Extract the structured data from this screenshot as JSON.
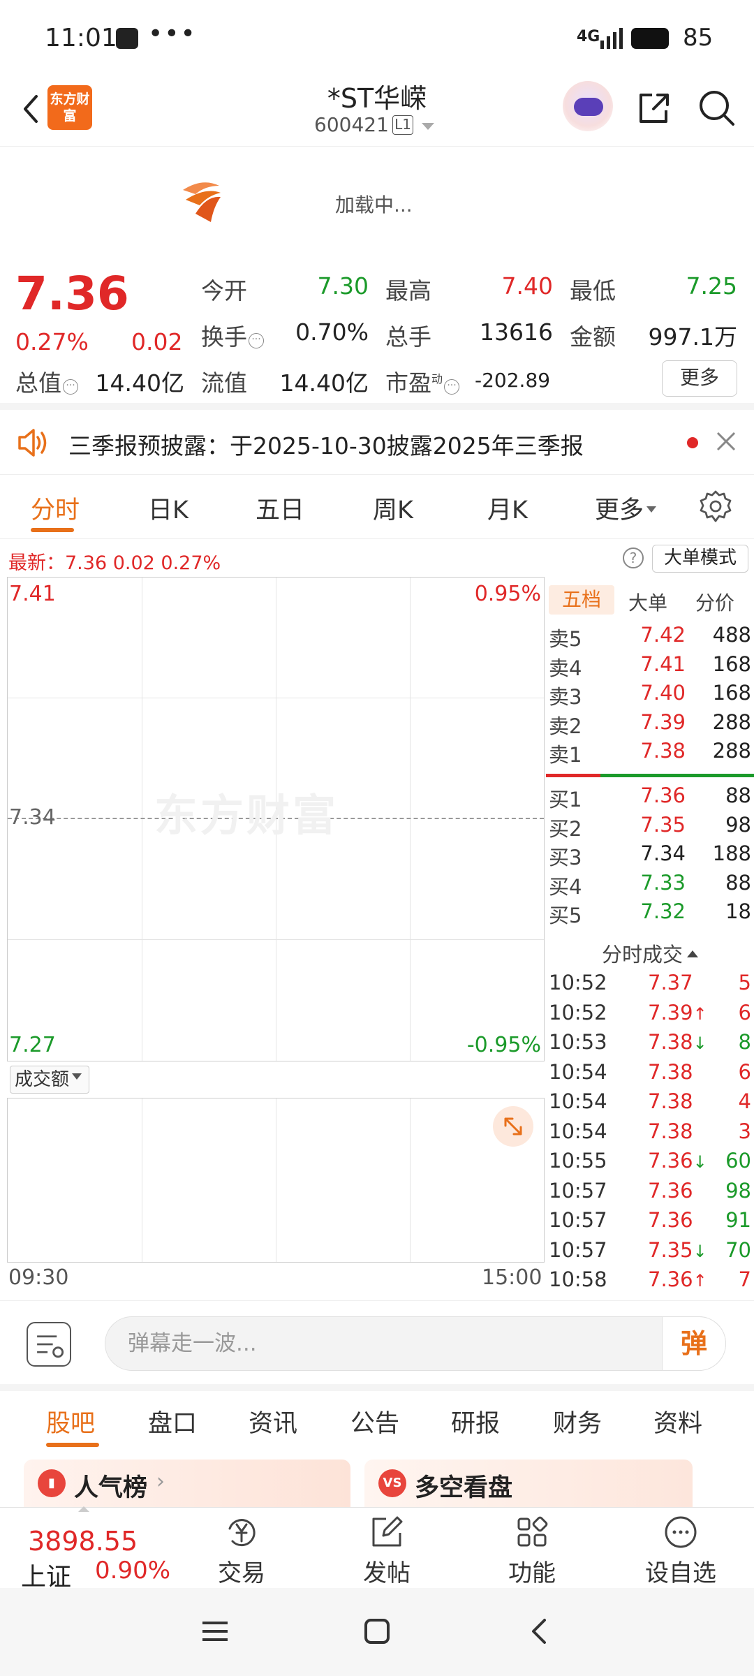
{
  "status": {
    "time": "11:01",
    "more": "•••",
    "network": "4G",
    "battery": "85"
  },
  "header": {
    "logo_text": "东方财富",
    "title": "*ST华嵘",
    "code": "600421",
    "level": "L1"
  },
  "banner": {
    "loading": "加载中..."
  },
  "quote": {
    "price": "7.36",
    "pct": "0.27%",
    "change": "0.02",
    "stats": [
      {
        "label": "今开",
        "value": "7.30",
        "color": "green"
      },
      {
        "label": "最高",
        "value": "7.40",
        "color": "red"
      },
      {
        "label": "最低",
        "value": "7.25",
        "color": "green"
      },
      {
        "label": "换手",
        "value": "0.70%",
        "color": "black"
      },
      {
        "label": "总手",
        "value": "13616",
        "color": "black"
      },
      {
        "label": "金额",
        "value": "997.1万",
        "color": "black"
      },
      {
        "label": "总值",
        "value": "14.40亿",
        "color": "black"
      },
      {
        "label": "流值",
        "value": "14.40亿",
        "color": "black"
      },
      {
        "label": "市盈",
        "value": "-202.89",
        "color": "black"
      }
    ],
    "pe_mark": "动",
    "more_label": "更多"
  },
  "notice": {
    "text": "三季报预披露：于2025-10-30披露2025年三季报"
  },
  "tabs": [
    "分时",
    "日K",
    "五日",
    "周K",
    "月K",
    "更多"
  ],
  "latest": {
    "text": "最新：7.36  0.02  0.27%",
    "bigorder": "大单模式",
    "help": "?"
  },
  "chart": {
    "watermark": "东方财富",
    "y_high": "7.41",
    "y_mid": "7.34",
    "y_low": "7.27",
    "pct_high": "0.95%",
    "pct_low": "-0.95%",
    "vol_label": "成交额",
    "time_start": "09:30",
    "time_end": "15:00"
  },
  "panel": {
    "tabs": [
      "五档",
      "大单",
      "分价"
    ],
    "asks": [
      {
        "label": "卖5",
        "price": "7.42",
        "vol": "488",
        "color": "red"
      },
      {
        "label": "卖4",
        "price": "7.41",
        "vol": "168",
        "color": "red"
      },
      {
        "label": "卖3",
        "price": "7.40",
        "vol": "168",
        "color": "red"
      },
      {
        "label": "卖2",
        "price": "7.39",
        "vol": "288",
        "color": "red"
      },
      {
        "label": "卖1",
        "price": "7.38",
        "vol": "288",
        "color": "red"
      }
    ],
    "bids": [
      {
        "label": "买1",
        "price": "7.36",
        "vol": "88",
        "color": "red"
      },
      {
        "label": "买2",
        "price": "7.35",
        "vol": "98",
        "color": "red"
      },
      {
        "label": "买3",
        "price": "7.34",
        "vol": "188",
        "color": "black"
      },
      {
        "label": "买4",
        "price": "7.33",
        "vol": "88",
        "color": "green"
      },
      {
        "label": "买5",
        "price": "7.32",
        "vol": "18",
        "color": "green"
      }
    ],
    "trades_header": "分时成交",
    "trades": [
      {
        "time": "10:52",
        "price": "7.37",
        "arrow": "",
        "vol": "5",
        "color": "red"
      },
      {
        "time": "10:52",
        "price": "7.39",
        "arrow": "↑",
        "vol": "6",
        "color": "red"
      },
      {
        "time": "10:53",
        "price": "7.38",
        "arrow": "↓",
        "vol": "8",
        "color": "green"
      },
      {
        "time": "10:54",
        "price": "7.38",
        "arrow": "",
        "vol": "6",
        "color": "red"
      },
      {
        "time": "10:54",
        "price": "7.38",
        "arrow": "",
        "vol": "4",
        "color": "red"
      },
      {
        "time": "10:54",
        "price": "7.38",
        "arrow": "",
        "vol": "3",
        "color": "red"
      },
      {
        "time": "10:55",
        "price": "7.36",
        "arrow": "↓",
        "vol": "60",
        "color": "green"
      },
      {
        "time": "10:57",
        "price": "7.36",
        "arrow": "",
        "vol": "98",
        "color": "green"
      },
      {
        "time": "10:57",
        "price": "7.36",
        "arrow": "",
        "vol": "91",
        "color": "green"
      },
      {
        "time": "10:57",
        "price": "7.35",
        "arrow": "↓",
        "vol": "70",
        "color": "green"
      },
      {
        "time": "10:58",
        "price": "7.36",
        "arrow": "↑",
        "vol": "7",
        "color": "red"
      }
    ]
  },
  "comment": {
    "placeholder": "弹幕走一波...",
    "send": "弹"
  },
  "sections": [
    "股吧",
    "盘口",
    "资讯",
    "公告",
    "研报",
    "财务",
    "资料"
  ],
  "cards": {
    "popular": "人气榜",
    "longshort": "多空看盘",
    "vs_badge": "VS"
  },
  "bottombar": {
    "index_value": "3898.55",
    "index_name": "上证",
    "index_pct": "0.90%",
    "nav": [
      "交易",
      "发帖",
      "功能",
      "设自选"
    ]
  },
  "colors": {
    "red": "#e02828",
    "green": "#1b9a2a",
    "accent": "#e8701a"
  }
}
